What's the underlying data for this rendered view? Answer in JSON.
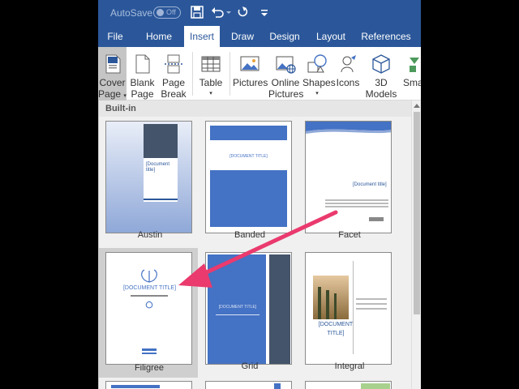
{
  "titlebar": {
    "autosave_label": "AutoSave",
    "autosave_state": "Off"
  },
  "tabs": [
    {
      "label": "File",
      "active": false
    },
    {
      "label": "Home",
      "active": false
    },
    {
      "label": "Insert",
      "active": true
    },
    {
      "label": "Draw",
      "active": false
    },
    {
      "label": "Design",
      "active": false
    },
    {
      "label": "Layout",
      "active": false
    },
    {
      "label": "References",
      "active": false
    }
  ],
  "ribbon": {
    "cover_page": {
      "line1": "Cover",
      "line2": "Page"
    },
    "blank_page": {
      "line1": "Blank",
      "line2": "Page"
    },
    "page_break": {
      "line1": "Page",
      "line2": "Break"
    },
    "table": {
      "line1": "Table"
    },
    "pictures": {
      "line1": "Pictures"
    },
    "online_pictures": {
      "line1": "Online",
      "line2": "Pictures"
    },
    "shapes": {
      "line1": "Shapes"
    },
    "icons": {
      "line1": "Icons"
    },
    "models_3d": {
      "line1": "3D",
      "line2": "Models"
    },
    "smartart": {
      "line1": "Sma"
    }
  },
  "gallery": {
    "section_title": "Built-in",
    "items": [
      {
        "name": "Austin"
      },
      {
        "name": "Banded"
      },
      {
        "name": "Facet"
      },
      {
        "name": "Filigree",
        "selected": true
      },
      {
        "name": "Grid"
      },
      {
        "name": "Integral"
      }
    ],
    "thumb_text": {
      "document_title_bracket": "[Document title]",
      "document_title_caps": "[DOCUMENT TITLE]",
      "document_title_integral_1": "[DOCUMENT",
      "document_title_integral_2": "TITLE]"
    }
  },
  "colors": {
    "ribbon_blue": "#2b579a",
    "accent_blue": "#4472c4",
    "arrow": "#ea3a6e"
  }
}
